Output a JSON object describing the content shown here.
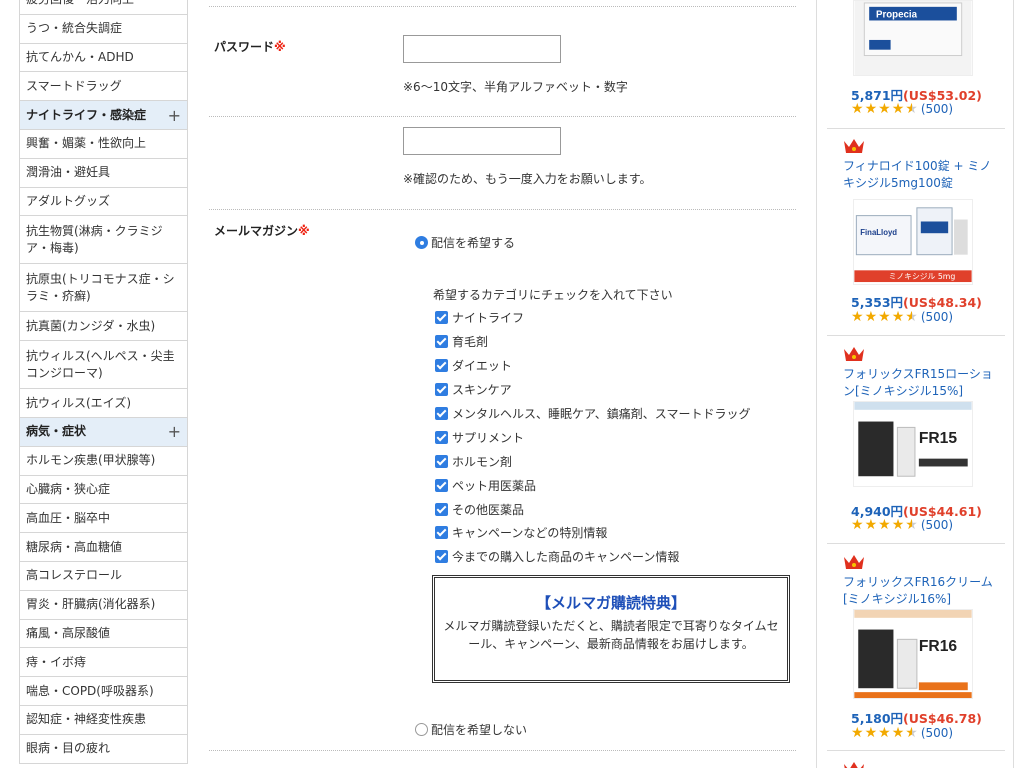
{
  "sidebar": {
    "items": [
      {
        "label": "疲労回復・活力向上"
      },
      {
        "label": "うつ・統合失調症"
      },
      {
        "label": "抗てんかん・ADHD"
      },
      {
        "label": "スマートドラッグ"
      },
      {
        "label": "ナイトライフ・感染症",
        "category": true,
        "plus": "+"
      },
      {
        "label": "興奮・媚薬・性欲向上"
      },
      {
        "label": "潤滑油・避妊具"
      },
      {
        "label": "アダルトグッズ"
      },
      {
        "label": "抗生物質(淋病・クラミジア・梅毒)",
        "two": true
      },
      {
        "label": "抗原虫(トリコモナス症・シラミ・疥癬)",
        "two": true
      },
      {
        "label": "抗真菌(カンジダ・水虫)"
      },
      {
        "label": "抗ウィルス(ヘルペス・尖圭コンジローマ)",
        "two": true
      },
      {
        "label": "抗ウィルス(エイズ)"
      },
      {
        "label": "病気・症状",
        "category": true,
        "plus": "+"
      },
      {
        "label": "ホルモン疾患(甲状腺等)"
      },
      {
        "label": "心臓病・狭心症"
      },
      {
        "label": "高血圧・脳卒中"
      },
      {
        "label": "糖尿病・高血糖値"
      },
      {
        "label": "高コレステロール"
      },
      {
        "label": "胃炎・肝臓病(消化器系)"
      },
      {
        "label": "痛風・高尿酸値"
      },
      {
        "label": "痔・イボ痔"
      },
      {
        "label": "喘息・COPD(呼吸器系)"
      },
      {
        "label": "認知症・神経変性疾患"
      },
      {
        "label": "眼病・目の疲れ"
      }
    ]
  },
  "form": {
    "password_label": "パスワード",
    "required_mark": "※",
    "password_value": "",
    "password_note": "※6〜10文字、半角アルファベット・数字",
    "password_confirm_value": "",
    "password_confirm_note": "※確認のため、もう一度入力をお願いします。",
    "newsletter_label": "メールマガジン",
    "radio_yes": "配信を希望する",
    "radio_no": "配信を希望しない",
    "category_intro": "希望するカテゴリにチェックを入れて下さい",
    "categories": [
      "ナイトライフ",
      "育毛剤",
      "ダイエット",
      "スキンケア",
      "メンタルヘルス、睡眠ケア、鎮痛剤、スマートドラッグ",
      "サプリメント",
      "ホルモン剤",
      "ペット用医薬品",
      "その他医薬品",
      "キャンペーンなどの特別情報",
      "今までの購入した商品のキャンペーン情報"
    ],
    "benefit_title": "【メルマガ購読特典】",
    "benefit_body": "メルマガ購読登録いただくと、購読者限定で耳寄りなタイムセール、キャンペーン、最新商品情報をお届けします。"
  },
  "products": [
    {
      "name": "",
      "price_jpy": "5,871円",
      "price_usd": "(US$53.02)",
      "rating": 4.5,
      "reviews": "(500)",
      "image_text": "Propecia"
    },
    {
      "name": "フィナロイド100錠 + ミノキシジル5mg100錠",
      "price_jpy": "5,353円",
      "price_usd": "(US$48.34)",
      "rating": 4.5,
      "reviews": "(500)",
      "image_text": "ミノキシジル 5mg"
    },
    {
      "name": "フォリックスFR15ローション[ミノキシジル15%]",
      "price_jpy": "4,940円",
      "price_usd": "(US$44.61)",
      "rating": 4.5,
      "reviews": "(500)",
      "image_text": "FR15"
    },
    {
      "name": "フォリックスFR16クリーム[ミノキシジル16%]",
      "price_jpy": "5,180円",
      "price_usd": "(US$46.78)",
      "rating": 4.5,
      "reviews": "(500)",
      "image_text": "FR16"
    }
  ],
  "colors": {
    "accent": "#1e63b8",
    "price_usd": "#e0402b",
    "category_bg": "#e4eef8",
    "checkbox": "#2f7de1",
    "required": "#ee2211"
  }
}
